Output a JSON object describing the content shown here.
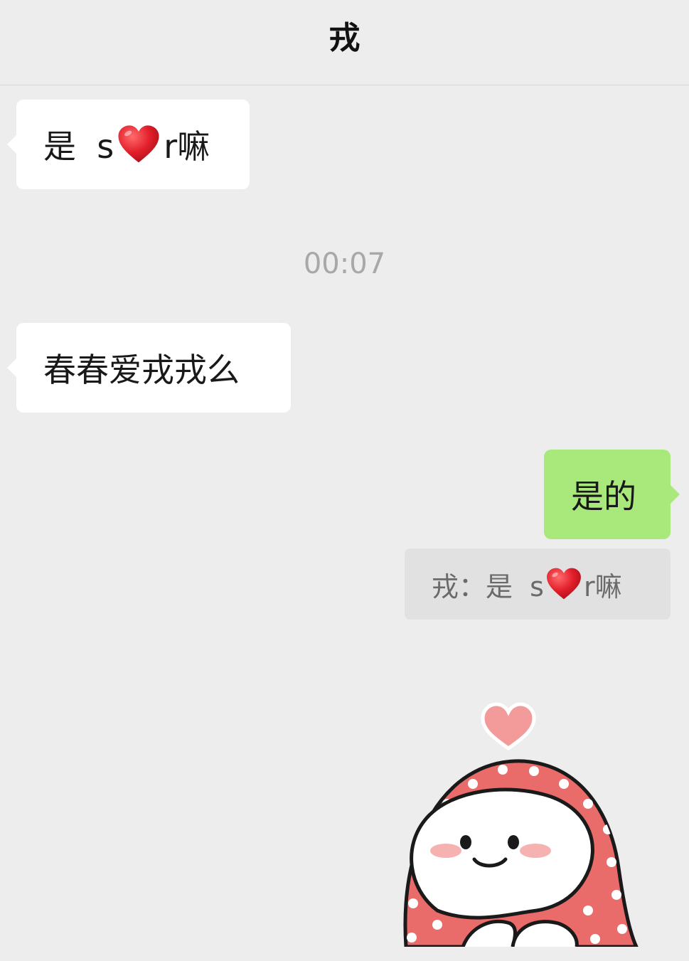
{
  "header": {
    "title": "戎"
  },
  "messages": [
    {
      "side": "left",
      "before_heart": "是  s",
      "after_heart": "r嘛"
    },
    {
      "side": "left",
      "text": "春春爱戎戎么"
    },
    {
      "side": "right",
      "text": "是的"
    }
  ],
  "timestamp": "00:07",
  "quote": {
    "prefix": "戎：",
    "before_heart": "是  s",
    "after_heart": "r嘛"
  },
  "icons": {
    "heart_emoji": "red-heart-icon",
    "sticker": "hooded-blob-sticker"
  },
  "colors": {
    "background": "#ededed",
    "left_bubble": "#ffffff",
    "right_bubble": "#a9e97b",
    "quote_bg": "#e1e1e1",
    "heart": "#e0303a",
    "sticker_hood": "#ea6c6a"
  }
}
